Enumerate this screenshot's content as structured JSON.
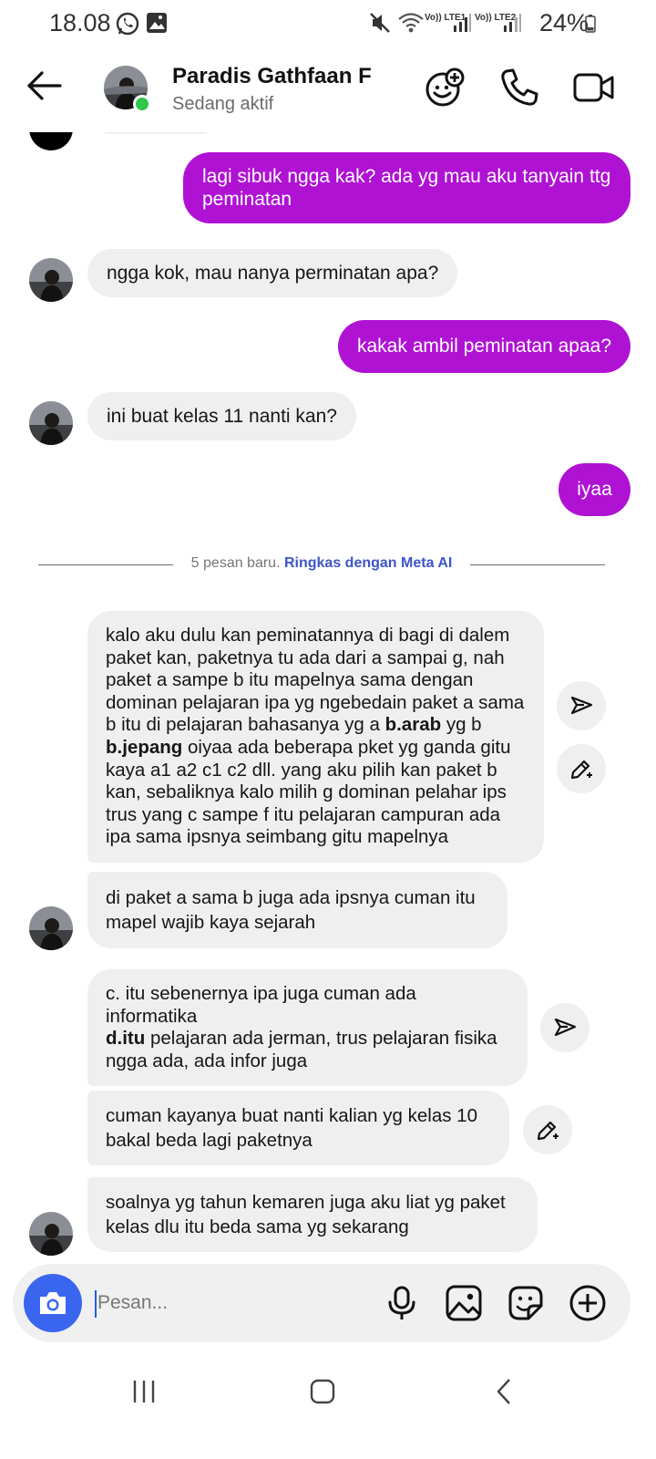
{
  "status_bar": {
    "time": "18.08",
    "battery": "24%",
    "network1_label": "Vo)) LTE1",
    "network2_label": "Vo)) LTE2",
    "icons": [
      "whatsapp-icon",
      "gallery-icon",
      "mute-icon",
      "wifi-icon",
      "signal-icon",
      "battery-icon"
    ]
  },
  "header": {
    "contact_name": "Paradis Gathfaan F",
    "contact_status": "Sedang aktif",
    "icons": [
      "back-arrow-icon",
      "avatar",
      "effects-icon",
      "phone-icon",
      "video-icon"
    ],
    "online_color": "#31c74a"
  },
  "messages": [
    {
      "side": "out",
      "text": "lagi sibuk ngga kak? ada yg mau aku tanyain ttg peminatan"
    },
    {
      "side": "in",
      "text": "ngga kok, mau nanya perminatan apa?"
    },
    {
      "side": "out",
      "text": "kakak ambil peminatan apaa?"
    },
    {
      "side": "in",
      "text": "ini buat kelas 11 nanti kan?"
    },
    {
      "side": "out",
      "text": "iyaa"
    }
  ],
  "divider": {
    "count_text": "5 pesan baru.",
    "link_text": "Ringkas dengan Meta AI"
  },
  "new_messages": {
    "m1": {
      "part1": "kalo aku dulu kan peminatannya di bagi di dalem paket kan, paketnya tu ada dari a sampai g, nah paket a sampe b itu mapelnya sama dengan dominan pelajaran ipa yg ngebedain paket a sama b itu di pelajaran bahasanya yg a ",
      "bold1": "b.arab",
      "part2": " yg b ",
      "bold2": "b.jepang",
      "part3": " oiyaa ada beberapa pket yg ganda gitu kaya a1 a2 c1 c2 dll. yang aku pilih kan paket b kan, sebaliknya kalo milih g dominan pelahar ips trus yang c sampe f itu pelajaran campuran ada ipa sama ipsnya seimbang gitu mapelnya"
    },
    "m2": "di paket a sama b juga ada ipsnya cuman itu mapel wajib kaya sejarah",
    "m3": {
      "line1": "c. itu sebenernya ipa juga cuman ada informatika",
      "bold": "d.itu",
      "rest": " pelajaran ada jerman, trus pelajaran fisika ngga ada, ada infor juga"
    },
    "m4": "cuman kayanya buat nanti kalian yg kelas 10 bakal beda lagi paketnya",
    "m5": "soalnya yg tahun kemaren juga aku liat yg paket kelas  dlu itu beda sama yg sekarang"
  },
  "side_actions": [
    "forward-icon",
    "edit-ai-icon"
  ],
  "composer": {
    "placeholder": "Pesan...",
    "value": "",
    "icons": [
      "camera-icon",
      "microphone-icon",
      "image-icon",
      "sticker-icon",
      "plus-icon"
    ],
    "camera_color": "#3a66ef"
  },
  "colors": {
    "outgoing_bubble": "#b012d4",
    "incoming_bubble": "#efefef",
    "link": "#3d55c6"
  },
  "nav_bar": {
    "icons": [
      "recents-icon",
      "home-icon",
      "back-icon"
    ]
  }
}
